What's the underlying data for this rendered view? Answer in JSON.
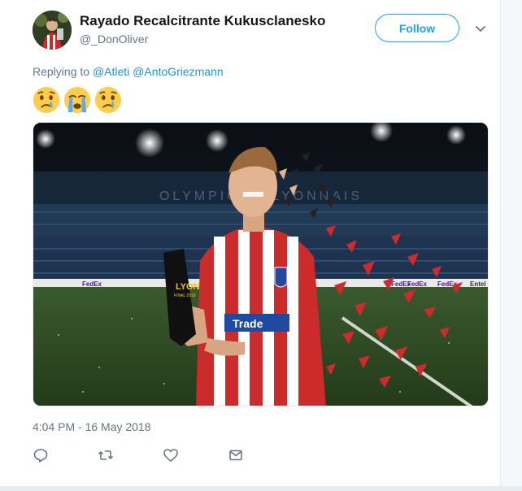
{
  "author": {
    "display_name": "Rayado Recalcitrante Kukusclanesko",
    "handle": "@_DonOliver"
  },
  "follow_label": "Follow",
  "reply_context": {
    "prefix": "Replying to",
    "mentions": [
      "@Atleti",
      "@AntoGriezmann"
    ]
  },
  "tweet_text_emojis": [
    "crying-face-icon",
    "crying-face-icon",
    "crying-face-icon"
  ],
  "media": {
    "trophy_text": "LYON",
    "trophy_sub": "FINAL 2018",
    "shirt_sponsor": "Trade",
    "board_texts": [
      "FedEx",
      "FedEx",
      "FedEx",
      "FedEx",
      "Entel"
    ],
    "stadium_text": "OLYMPIQUE LYONNAIS"
  },
  "timestamp": "4:04 PM - 16 May 2018",
  "actions": [
    "reply-icon",
    "retweet-icon",
    "like-icon",
    "direct-message-icon"
  ],
  "colors": {
    "accent": "#1da1f2",
    "link": "#1b95e0",
    "muted": "#657786"
  }
}
